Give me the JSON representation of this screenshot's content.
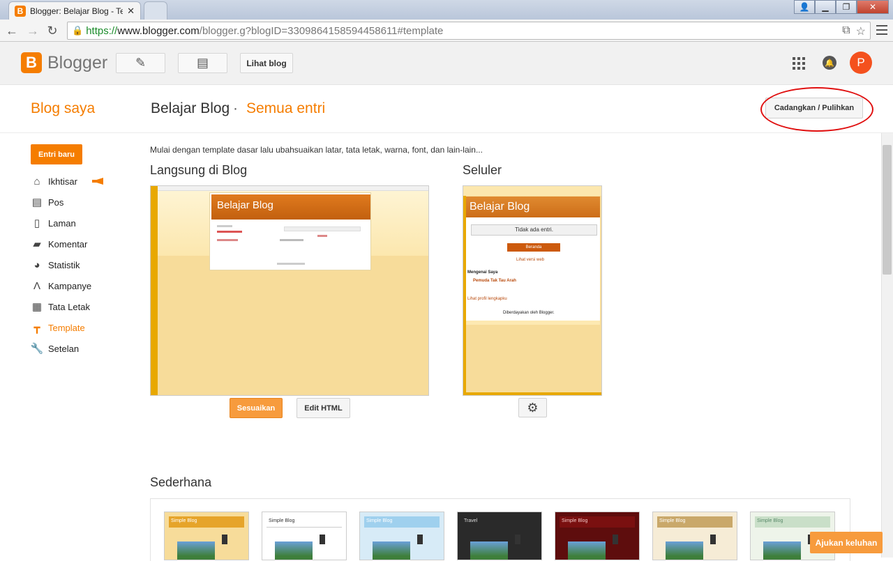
{
  "browser": {
    "active_tab_title": "Blogger: Belajar Blog - Te",
    "url_https": "https://",
    "url_host": "www.blogger.com",
    "url_path": "/blogger.g?blogID=3309864158594458611#template"
  },
  "header": {
    "logo_text": "Blogger",
    "lihat_blog": "Lihat blog",
    "avatar_letter": "P"
  },
  "subheader": {
    "blog_saya": "Blog saya",
    "blog_title": "Belajar Blog",
    "separator": "·",
    "semua_entri": "Semua entri",
    "backup_button": "Cadangkan / Pulihkan"
  },
  "sidebar": {
    "new_post": "Entri baru",
    "items": [
      {
        "label": "Ikhtisar",
        "icon": "home-icon"
      },
      {
        "label": "Pos",
        "icon": "posts-icon"
      },
      {
        "label": "Laman",
        "icon": "pages-icon"
      },
      {
        "label": "Komentar",
        "icon": "comment-icon"
      },
      {
        "label": "Statistik",
        "icon": "pie-chart-icon"
      },
      {
        "label": "Kampanye",
        "icon": "adwords-icon"
      },
      {
        "label": "Tata Letak",
        "icon": "layout-icon"
      },
      {
        "label": "Template",
        "icon": "template-icon"
      },
      {
        "label": "Setelan",
        "icon": "wrench-icon"
      }
    ],
    "active": "Template"
  },
  "main": {
    "intro": "Mulai dengan template dasar lalu ubahsuaikan latar, tata letak, warna, font, dan lain-lain...",
    "live_label": "Langsung di Blog",
    "mobile_label": "Seluler",
    "preview_blog_title": "Belajar Blog",
    "mobile_preview": {
      "blog_title": "Belajar Blog",
      "no_entries": "Tidak ada entri.",
      "home": "Beranda",
      "web_version": "Lihat versi web",
      "about_me": "Mengenai Saya",
      "profile_name": "Pemuda Tak Tau Arah",
      "full_profile": "Lihat profil lengkapku",
      "powered_by": "Diberdayakan oleh Blogger."
    },
    "customize_button": "Sesuaikan",
    "edit_html_button": "Edit HTML",
    "simple_label": "Sederhana",
    "themes": [
      {
        "title": "Simple Blog",
        "color": "#e6a42a"
      },
      {
        "title": "Simple Blog",
        "color": "#ffffff"
      },
      {
        "title": "Simple Blog",
        "color": "#9fd0ee"
      },
      {
        "title": "Travel",
        "color": "#2a2a2a"
      },
      {
        "title": "Simple Blog",
        "color": "#7a1010"
      },
      {
        "title": "Simple Blog",
        "color": "#c9a86a"
      },
      {
        "title": "Simple Blog",
        "color": "#c9dfc8"
      }
    ]
  },
  "feedback_button": "Ajukan keluhan",
  "colors": {
    "accent": "#f57d00",
    "highlight_ellipse": "#e01010"
  }
}
